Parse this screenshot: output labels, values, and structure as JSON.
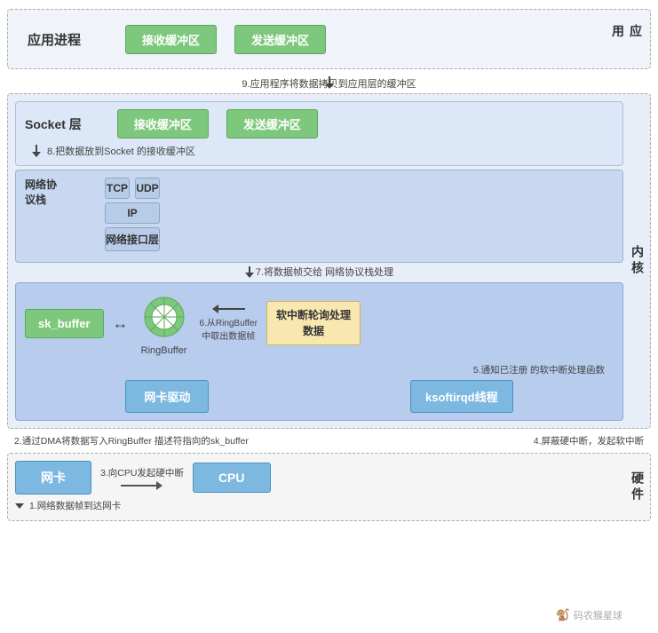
{
  "app": {
    "title": "应用进程",
    "recv_buf": "接收缓冲区",
    "send_buf": "发送缓冲区",
    "side_label": "应用"
  },
  "step9": {
    "label": "9.应用程序将数据拷贝到应用层的缓冲区"
  },
  "socket": {
    "label": "Socket 层",
    "recv_buf": "接收缓冲区",
    "send_buf": "发送缓冲区"
  },
  "step8": {
    "label": "8.把数据放到Socket   的接收缓冲区"
  },
  "protocol": {
    "title": "网络协议栈",
    "tcp": "TCP",
    "udp": "UDP",
    "ip": "IP",
    "netif": "网络接口层"
  },
  "step7": {
    "label": "7.将数据帧交给  网络协议栈处理"
  },
  "kernel_label": "内核",
  "driver": {
    "sk_buffer": "sk_buffer",
    "ring_buffer": "RingBuffer",
    "softirq": "软中断轮询处理\n数据",
    "nic_driver": "网卡驱动",
    "ksoftirqd": "ksoftirqd线程"
  },
  "step6": {
    "label": "6.从RingBuffer\n中取出数据帧"
  },
  "step5": {
    "label": "5.通知已注册  的软中断处理函数"
  },
  "step2": {
    "label": "2.通过DMA将数据写入RingBuffer  描述符指向的sk_buffer"
  },
  "step4": {
    "label": "4.屏蔽硬中断，发起软中断"
  },
  "hardware": {
    "nic": "网卡",
    "cpu": "CPU",
    "side_label": "硬件"
  },
  "step3": {
    "label": "3.向CPU发起硬中断"
  },
  "step1": {
    "label": "1.网络数据帧到达网卡"
  },
  "watermark": "码农猴星球"
}
